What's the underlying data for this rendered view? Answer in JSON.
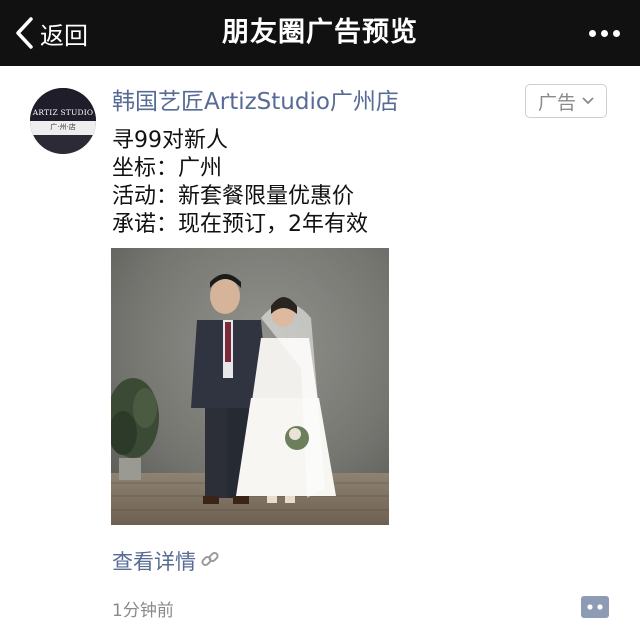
{
  "nav": {
    "back_label": "返回",
    "title": "朋友圈广告预览"
  },
  "ad": {
    "avatar": {
      "brand_text": "ARTIZ STUDIO",
      "city_text": "广·州·店"
    },
    "advertiser_name": "韩国艺匠ArtizStudio广州店",
    "tag_label": "广告",
    "lines": [
      "寻99对新人",
      "坐标：广州",
      "活动：新套餐限量优惠价",
      "承诺：现在预订，2年有效"
    ],
    "image_alt": "wedding couple photo",
    "detail_link": "查看详情",
    "time": "1分钟前"
  },
  "colors": {
    "topbar": "#111111",
    "link_blue": "#576b95",
    "gray_text": "#8a8a8a"
  },
  "icons": [
    "back-chevron-icon",
    "more-dots-icon",
    "chevron-down-icon",
    "link-icon",
    "comment-icon"
  ]
}
